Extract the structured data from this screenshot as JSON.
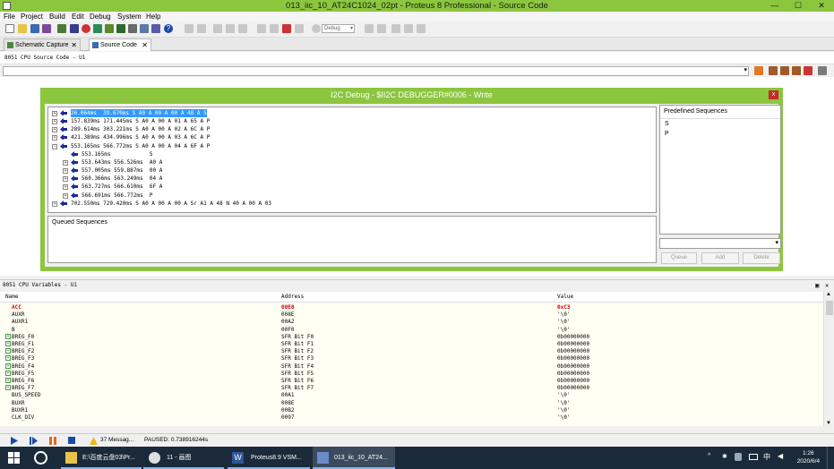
{
  "window": {
    "title": "013_iic_10_AT24C1024_02pt - Proteus 8 Professional - Source Code",
    "buttons": {
      "minimize": "—",
      "maximize": "☐",
      "close": "✕"
    }
  },
  "menu": [
    "File",
    "Project",
    "Build",
    "Edit",
    "Debug",
    "System",
    "Help"
  ],
  "toolbar": {
    "config_select": "Debug"
  },
  "tabs": [
    {
      "label": "Schematic Capture",
      "close": "✕"
    },
    {
      "label": "Source Code",
      "close": "✕"
    }
  ],
  "source_panel": {
    "title": "8051 CPU Source Code - U1"
  },
  "i2c_dialog": {
    "title": "I2C Debug - $II2C DEBUGGER#0006 - Write",
    "close": "x",
    "rows": [
      {
        "toggle": "+",
        "text": "26.064ms  39.670ms S A0 A 00 A 00 A 48 A S",
        "selected": true
      },
      {
        "toggle": "+",
        "text": "157.839ms 171.445ms S A0 A 00 A 01 A 65 A P"
      },
      {
        "toggle": "+",
        "text": "289.614ms 303.221ms S A0 A 00 A 02 A 6C A P"
      },
      {
        "toggle": "+",
        "text": "421.389ms 434.996ms S A0 A 00 A 03 A 6C A P"
      },
      {
        "toggle": "−",
        "text": "553.165ms 566.772ms S A0 A 00 A 04 A 6F A P"
      },
      {
        "toggle": "",
        "text": "553.165ms            S",
        "child": true
      },
      {
        "toggle": "+",
        "text": "553.643ms 556.526ms  A0 A",
        "child": true
      },
      {
        "toggle": "+",
        "text": "557.005ms 559.887ms  00 A",
        "child": true
      },
      {
        "toggle": "+",
        "text": "560.366ms 563.249ms  04 A",
        "child": true
      },
      {
        "toggle": "+",
        "text": "563.727ms 566.610ms  6F A",
        "child": true
      },
      {
        "toggle": "+",
        "text": "566.691ms 566.772ms  P",
        "child": true
      },
      {
        "toggle": "+",
        "text": "702.550ms 729.420ms S A0 A 00 A 00 A Sr A1 A 48 N 40 A 00 A 03"
      }
    ],
    "queued_label": "Queued Sequences",
    "predefined_label": "Predefined Sequences",
    "predefined_items": [
      "S",
      "P"
    ],
    "buttons": {
      "queue": "Queue",
      "add": "Add",
      "delete": "Delete"
    }
  },
  "variables_panel": {
    "title": "8051 CPU Variables - U1",
    "columns": {
      "name": "Name",
      "address": "Address",
      "value": "Value"
    },
    "rows": [
      {
        "name": "ACC",
        "address": "00E0",
        "value": "0xC3",
        "changed": true,
        "expandable": false
      },
      {
        "name": "AUXR",
        "address": "008E",
        "value": "'\\0'",
        "expandable": false
      },
      {
        "name": "AUXR1",
        "address": "00A2",
        "value": "'\\0'",
        "expandable": false
      },
      {
        "name": "B",
        "address": "00F0",
        "value": "'\\0'",
        "expandable": false
      },
      {
        "name": "BREG_F0",
        "address": "SFR Bit F0",
        "value": "0b00000000",
        "expandable": true
      },
      {
        "name": "BREG_F1",
        "address": "SFR Bit F1",
        "value": "0b00000000",
        "expandable": true
      },
      {
        "name": "BREG_F2",
        "address": "SFR Bit F2",
        "value": "0b00000000",
        "expandable": true
      },
      {
        "name": "BREG_F3",
        "address": "SFR Bit F3",
        "value": "0b00000000",
        "expandable": true
      },
      {
        "name": "BREG_F4",
        "address": "SFR Bit F4",
        "value": "0b00000000",
        "expandable": true
      },
      {
        "name": "BREG_F5",
        "address": "SFR Bit F5",
        "value": "0b00000000",
        "expandable": true
      },
      {
        "name": "BREG_F6",
        "address": "SFR Bit F6",
        "value": "0b00000000",
        "expandable": true
      },
      {
        "name": "BREG_F7",
        "address": "SFR Bit F7",
        "value": "0b00000000",
        "expandable": true
      },
      {
        "name": "BUS_SPEED",
        "address": "00A1",
        "value": "'\\0'",
        "expandable": false
      },
      {
        "name": "BUXR",
        "address": "008E",
        "value": "'\\0'",
        "expandable": false
      },
      {
        "name": "BUXR1",
        "address": "00B2",
        "value": "'\\0'",
        "expandable": false
      },
      {
        "name": "CLK_DIV",
        "address": "0097",
        "value": "'\\0'",
        "expandable": false
      }
    ]
  },
  "status": {
    "messages": "37 Messag...",
    "paused": "PAUSED: 0.738916244s"
  },
  "taskbar": {
    "items": [
      {
        "label": "E:\\百度云盘03\\Pr..."
      },
      {
        "label": "11 - 画图"
      },
      {
        "label": "Proteus8.9 VSM..."
      },
      {
        "label": "013_iic_10_AT24..."
      }
    ],
    "ime": "中",
    "time": "1:26",
    "date": "2020/6/4"
  },
  "colors": {
    "accent": "#8cc63e",
    "selection": "#3399ff",
    "changed_value": "#d40000",
    "arrow": "#1a2a9a"
  }
}
